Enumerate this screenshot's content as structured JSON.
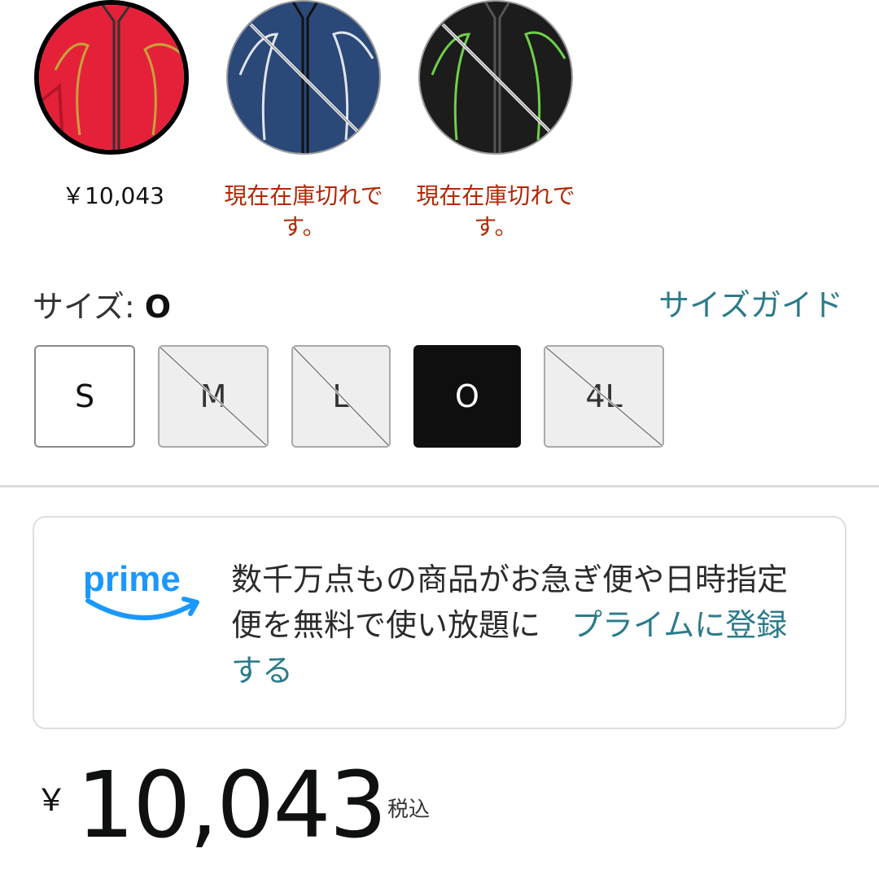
{
  "colors": {
    "accent_link": "#2c7b8a",
    "out_of_stock_text": "#b12704",
    "selected_border": "#000000",
    "swatch_red": "#e5213a",
    "swatch_navy": "#2a4878",
    "swatch_black": "#1c1c1c"
  },
  "swatches": [
    {
      "color_name": "red",
      "caption_line1": "￥10,043",
      "caption_line2": "",
      "selected": true,
      "out_of_stock": false
    },
    {
      "color_name": "navy",
      "caption_line1": "現在在庫切れで",
      "caption_line2": "す。",
      "selected": false,
      "out_of_stock": true
    },
    {
      "color_name": "black",
      "caption_line1": "現在在庫切れで",
      "caption_line2": "す。",
      "selected": false,
      "out_of_stock": true
    }
  ],
  "size": {
    "label": "サイズ: ",
    "selected_value": "O",
    "guide_link": "サイズガイド",
    "options": [
      {
        "label": "S",
        "state": "available"
      },
      {
        "label": "M",
        "state": "out_of_stock"
      },
      {
        "label": "L",
        "state": "out_of_stock"
      },
      {
        "label": "O",
        "state": "selected"
      },
      {
        "label": "4L",
        "state": "out_of_stock"
      }
    ]
  },
  "prime": {
    "logo_text": "prime",
    "message": "数千万点もの商品がお急ぎ便や日時指定便を無料で使い放題に　",
    "link": "プライムに登録する"
  },
  "price": {
    "currency": "￥",
    "amount": "10,043",
    "tax_note": "税込"
  }
}
